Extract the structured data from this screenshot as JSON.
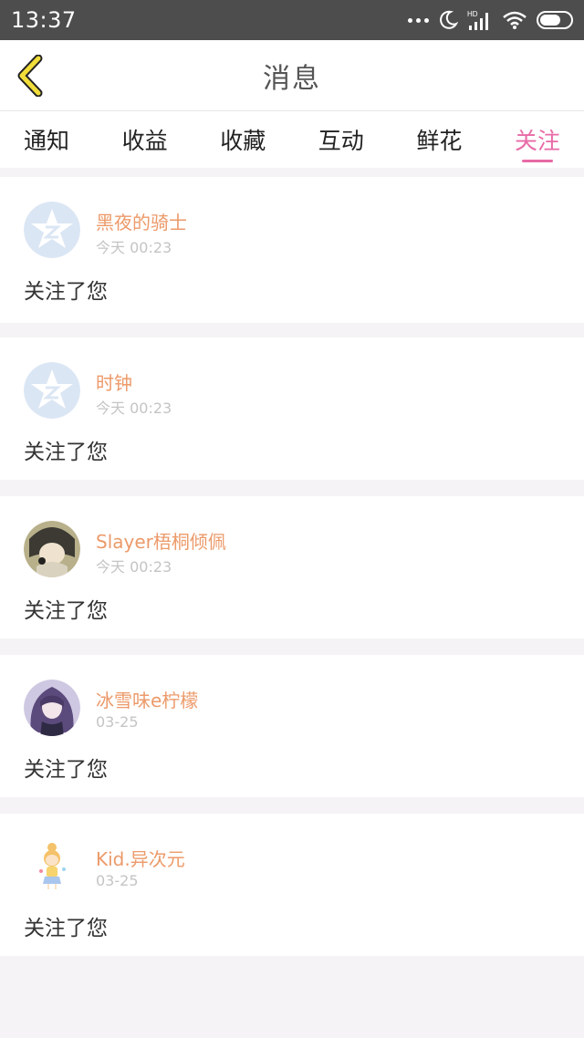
{
  "status_bar": {
    "time": "13:37",
    "icons": [
      "more-dots-icon",
      "moon-icon",
      "signal-icon",
      "wifi-icon",
      "battery-icon"
    ],
    "hd_label": "HD"
  },
  "header": {
    "title": "消息",
    "back_icon": "chevron-left-icon",
    "accent_color": "#f1dd3a"
  },
  "tabs": [
    {
      "label": "通知",
      "active": false
    },
    {
      "label": "收益",
      "active": false
    },
    {
      "label": "收藏",
      "active": false
    },
    {
      "label": "互动",
      "active": false
    },
    {
      "label": "鲜花",
      "active": false
    },
    {
      "label": "关注",
      "active": true
    }
  ],
  "colors": {
    "active_tab": "#e86aa6",
    "username": "#ec9a6a",
    "timestamp": "#c4c4c4"
  },
  "items": [
    {
      "name": "黑夜的骑士",
      "time": "今天 00:23",
      "message": "关注了您",
      "avatar": "qzone-default-avatar"
    },
    {
      "name": "时钟",
      "time": "今天 00:23",
      "message": "关注了您",
      "avatar": "qzone-default-avatar"
    },
    {
      "name": "Slayer梧桐倾佩",
      "time": "今天 00:23",
      "message": "关注了您",
      "avatar": "anime-girl-avatar"
    },
    {
      "name": "冰雪味e柠檬",
      "time": "03-25",
      "message": "关注了您",
      "avatar": "purple-hair-girl-avatar"
    },
    {
      "name": "Kid.异次元",
      "time": "03-25",
      "message": "关注了您",
      "avatar": "cartoon-girl-avatar"
    }
  ]
}
